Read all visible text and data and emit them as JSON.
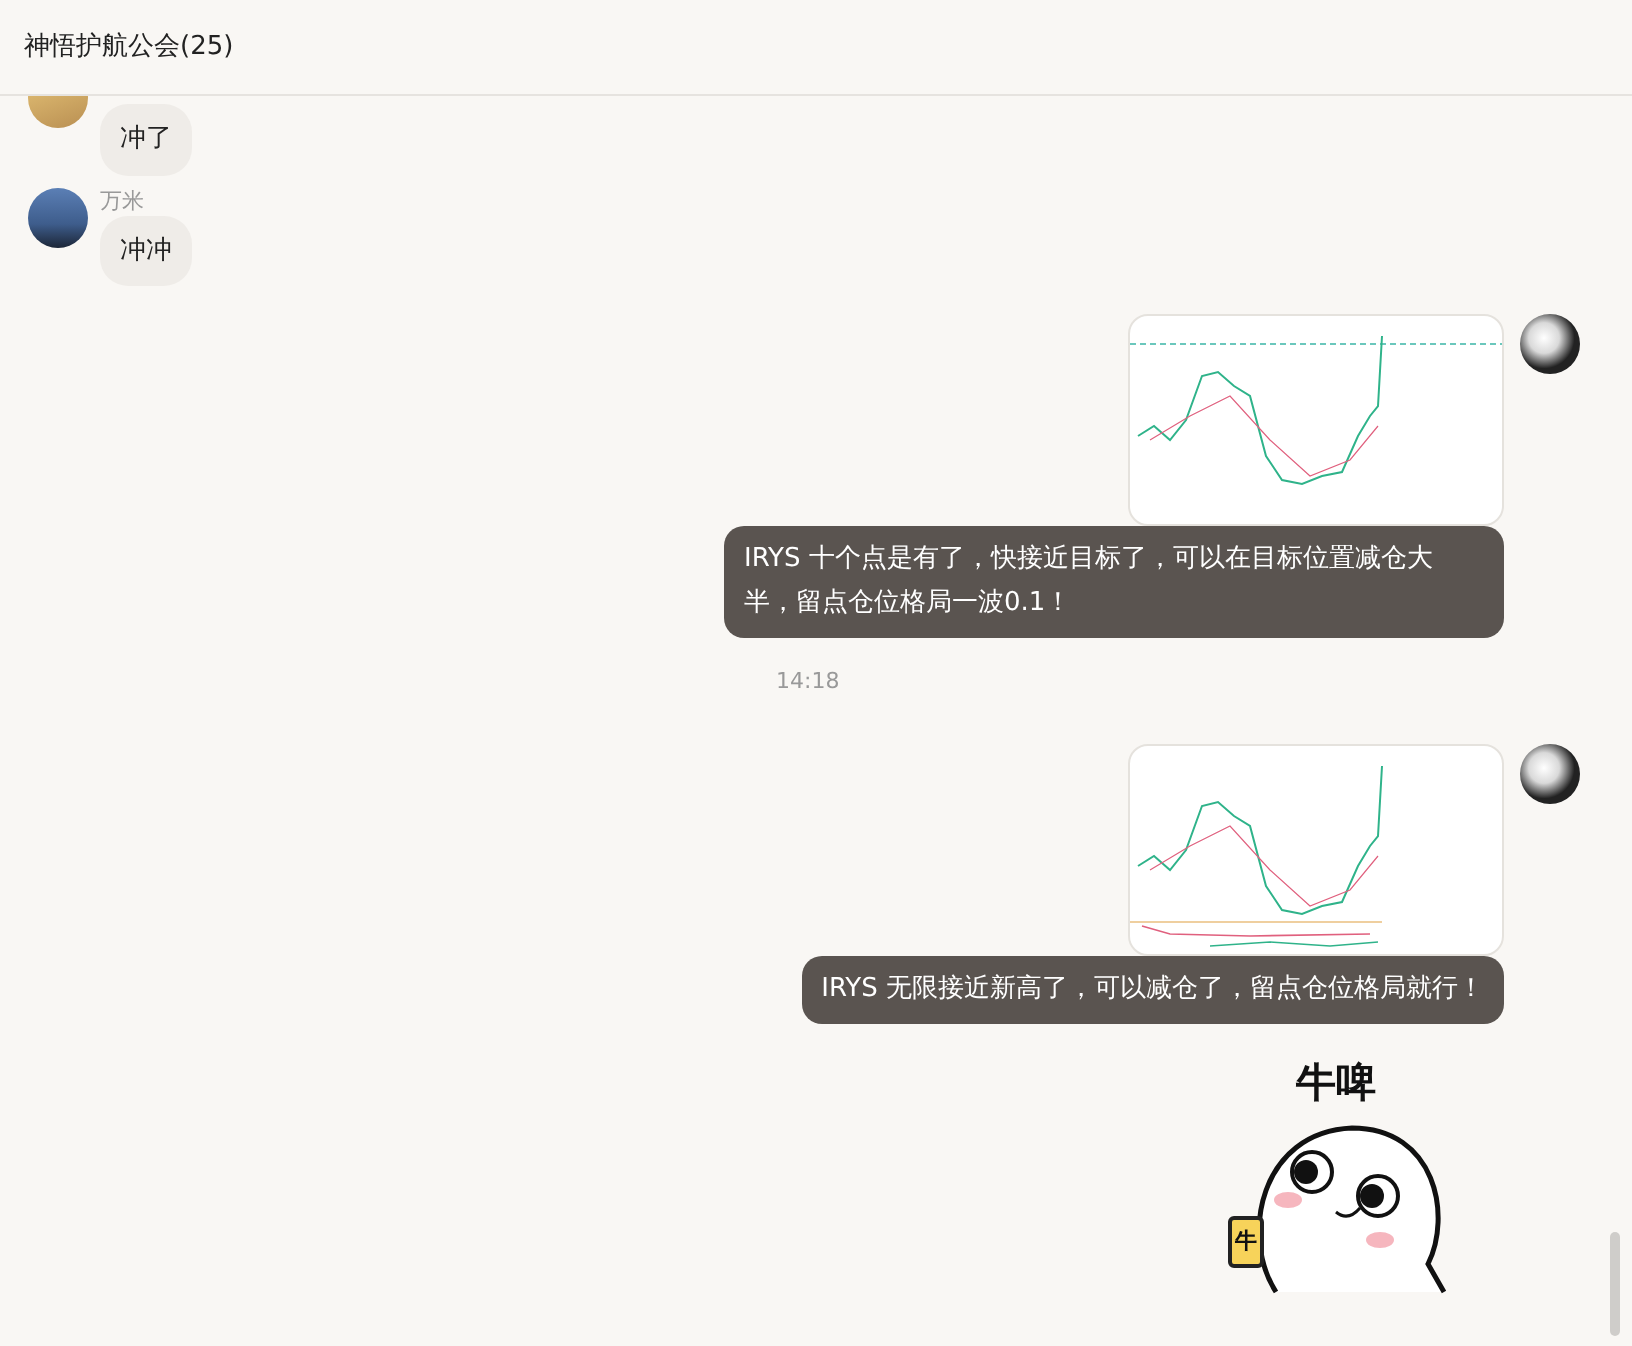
{
  "header": {
    "title": "神悟护航公会(25)"
  },
  "messages": [
    {
      "kind": "received",
      "text": "冲了"
    },
    {
      "kind": "received",
      "sender": "万米",
      "text": "冲冲"
    },
    {
      "kind": "sent_image",
      "caption": "IRYS 十个点是有了，快接近目标了，可以在目标位置减仓大半，留点仓位格局一波0.1！"
    },
    {
      "kind": "time",
      "text": "14:18"
    },
    {
      "kind": "sent_image",
      "caption": "IRYS 无限接近新高了，可以减仓了，留点仓位格局就行！"
    },
    {
      "kind": "sticker",
      "caption": "牛啤",
      "mug_label": "牛"
    }
  ]
}
